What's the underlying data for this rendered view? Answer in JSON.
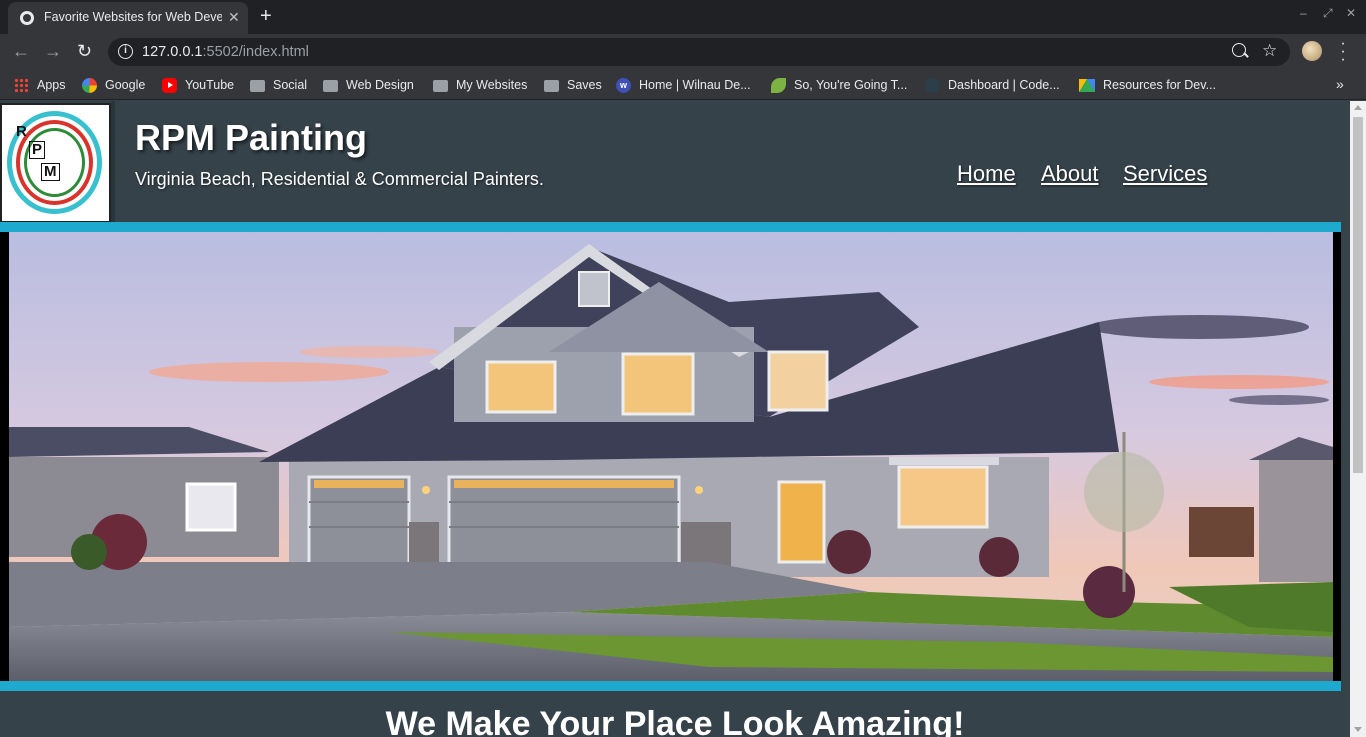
{
  "browser": {
    "tab_title": "Favorite Websites for Web Deve",
    "url_host": "127.0.0.1",
    "url_path": ":5502/index.html",
    "bookmarks": [
      {
        "label": "Apps",
        "icon": "apps-grid-icon"
      },
      {
        "label": "Google",
        "icon": "google-icon"
      },
      {
        "label": "YouTube",
        "icon": "youtube-icon"
      },
      {
        "label": "Social",
        "icon": "folder-icon"
      },
      {
        "label": "Web Design",
        "icon": "folder-icon"
      },
      {
        "label": "My Websites",
        "icon": "folder-icon"
      },
      {
        "label": "Saves",
        "icon": "folder-icon"
      },
      {
        "label": "Home | Wilnau De...",
        "icon": "wilnau-icon"
      },
      {
        "label": "So, You're Going T...",
        "icon": "leaf-icon"
      },
      {
        "label": "Dashboard | Code...",
        "icon": "codecademy-icon"
      },
      {
        "label": "Resources for Dev...",
        "icon": "google-drive-icon"
      }
    ]
  },
  "site": {
    "logo_letters": [
      "R",
      "P",
      "M"
    ],
    "title": "RPM Painting",
    "tagline": "Virginia Beach, Residential & Commercial Painters.",
    "nav": [
      "Home",
      "About",
      "Services"
    ],
    "headline": "We Make Your Place Look Amazing!"
  },
  "colors": {
    "page_bg": "#35424a",
    "accent": "#1ea9cf",
    "chrome_dark": "#202124",
    "chrome_mid": "#35363a"
  }
}
